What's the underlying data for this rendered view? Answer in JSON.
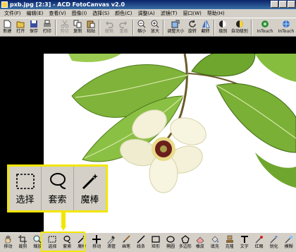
{
  "window": {
    "title": "pxb.jpg [2:3] - ACD FotoCanvas v2.0"
  },
  "menu": [
    "文件(F)",
    "编辑(E)",
    "查看(V)",
    "图像(I)",
    "选择(S)",
    "颜色(C)",
    "调整(A)",
    "滤镜(T)",
    "窗口(W)",
    "帮助(H)"
  ],
  "toolbar": {
    "items": [
      {
        "label": "新建",
        "icon": "new-file-icon"
      },
      {
        "label": "打开",
        "icon": "open-folder-icon"
      },
      {
        "label": "保存",
        "icon": "save-icon"
      },
      {
        "label": "打印",
        "icon": "print-icon"
      },
      {
        "label": "剪切",
        "icon": "scissors-icon",
        "disabled": true
      },
      {
        "label": "复制",
        "icon": "copy-icon"
      },
      {
        "label": "粘贴",
        "icon": "paste-icon"
      },
      {
        "label": "撤销",
        "icon": "undo-icon",
        "disabled": true
      },
      {
        "label": "重做",
        "icon": "redo-icon",
        "disabled": true
      },
      {
        "label": "缩小",
        "icon": "zoom-out-icon"
      },
      {
        "label": "放大",
        "icon": "zoom-in-icon"
      },
      {
        "label": "调整大小",
        "icon": "resize-icon"
      },
      {
        "label": "旋转",
        "icon": "rotate-icon"
      },
      {
        "label": "翻转",
        "icon": "flip-icon"
      },
      {
        "label": "级别",
        "icon": "levels-icon"
      },
      {
        "label": "自动级别",
        "icon": "auto-levels-icon"
      },
      {
        "label": "InTouch",
        "icon": "intouch-icon"
      },
      {
        "label": "InTouch",
        "icon": "globe-icon"
      }
    ]
  },
  "callout": {
    "items": [
      {
        "label": "选择",
        "icon": "selection-icon"
      },
      {
        "label": "套索",
        "icon": "lasso-icon"
      },
      {
        "label": "魔棒",
        "icon": "magic-wand-icon"
      }
    ]
  },
  "bottom_toolbar": {
    "items": [
      {
        "label": "移动",
        "icon": "hand-icon"
      },
      {
        "label": "裁剪",
        "icon": "crop-icon"
      },
      {
        "label": "缩放",
        "icon": "magnifier-icon"
      },
      {
        "label": "选择",
        "icon": "selection-icon"
      },
      {
        "label": "套索",
        "icon": "lasso-icon"
      },
      {
        "label": "魔棒",
        "icon": "magic-wand-icon"
      },
      {
        "label": "移动",
        "icon": "move-icon"
      },
      {
        "label": "滴管",
        "icon": "eyedropper-icon"
      },
      {
        "label": "画笔",
        "icon": "brush-icon"
      },
      {
        "label": "线条",
        "icon": "line-icon"
      },
      {
        "label": "矩形",
        "icon": "rectangle-icon"
      },
      {
        "label": "椭圆",
        "icon": "ellipse-icon"
      },
      {
        "label": "多边形",
        "icon": "polygon-icon"
      },
      {
        "label": "橡皮",
        "icon": "eraser-icon"
      },
      {
        "label": "填充",
        "icon": "fill-icon"
      },
      {
        "label": "克隆",
        "icon": "clone-icon"
      },
      {
        "label": "文字",
        "icon": "text-icon"
      },
      {
        "label": "红眼",
        "icon": "red-eye-icon"
      },
      {
        "label": "锐化",
        "icon": "sharpen-icon"
      },
      {
        "label": "模糊",
        "icon": "blur-icon"
      }
    ]
  },
  "colors": {
    "highlight": "#f2e600",
    "chrome": "#d4d0c8",
    "titlebar": "#0a246a",
    "leaf": "#6fa62e",
    "petal": "#f4f1d8",
    "center": "#6b1f1b"
  }
}
